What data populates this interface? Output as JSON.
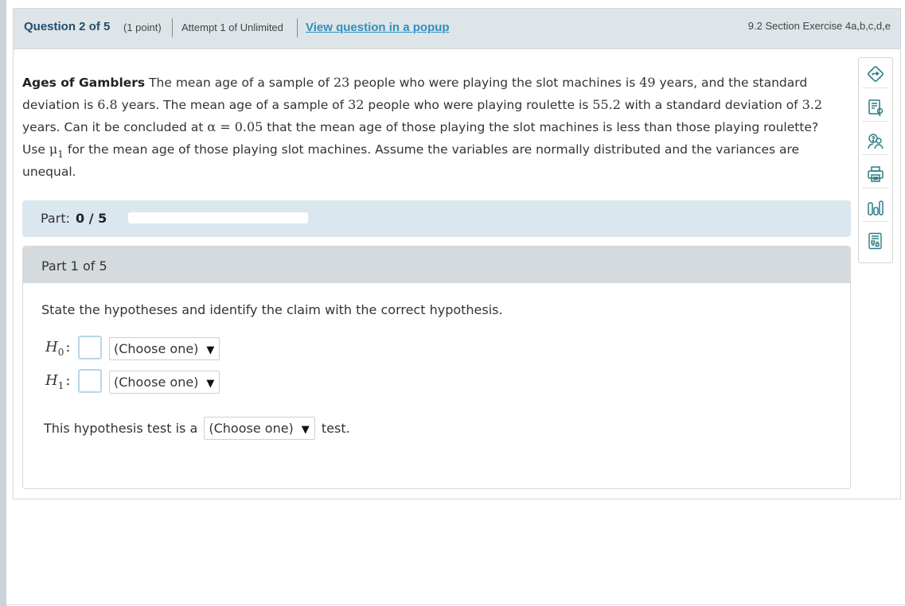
{
  "header": {
    "question_number": "Question 2 of 5",
    "points": "(1 point)",
    "attempt": "Attempt 1 of Unlimited",
    "popup_link": "View question in a popup",
    "section": "9.2 Section Exercise 4a,b,c,d,e"
  },
  "question": {
    "title": "Ages of Gamblers",
    "s1": " The mean age of a sample of ",
    "n1": "23",
    "s2": " people who were playing the slot machines is ",
    "m1": "49",
    "s3": " years, and the standard deviation is ",
    "sd1": "6.8",
    "s4": " years. The mean age of a sample of ",
    "n2": "32",
    "s5": " people who were playing roulette is ",
    "m2": "55.2",
    "s6": " with a standard deviation of ",
    "sd2": "3.2",
    "s7": " years. Can it be concluded at ",
    "alpha_expr": "α = 0.05",
    "s8": " that the mean age of those playing the slot machines is less than those playing roulette? Use ",
    "mu": "μ",
    "mu_sub": "1",
    "s9": " for the mean age of those playing slot machines. Assume the variables are normally distributed and the variances are unequal."
  },
  "progress": {
    "label": "Part:",
    "score": "0 / 5",
    "fraction": 0.0
  },
  "part": {
    "title": "Part 1 of 5",
    "instruction": "State the hypotheses and identify the claim with the correct hypothesis.",
    "h0": {
      "symbol": "H",
      "sub": "0",
      "colon": ":",
      "select": "(Choose one)"
    },
    "h1": {
      "symbol": "H",
      "sub": "1",
      "colon": ":",
      "select": "(Choose one)"
    },
    "test_prefix": "This hypothesis test is a",
    "test_select": "(Choose one)",
    "test_suffix": "test.",
    "arrow": "▼"
  },
  "tools": [
    {
      "icon": "exit-arrow-icon"
    },
    {
      "icon": "hint-document-icon"
    },
    {
      "icon": "ask-question-icon"
    },
    {
      "icon": "printer-icon"
    },
    {
      "icon": "bar-chart-icon"
    },
    {
      "icon": "calculator-icon"
    }
  ],
  "colors": {
    "accent": "#2f8fbf",
    "header_bg": "#dde5e9",
    "part_bar_bg": "#dbe7ef",
    "icon": "#2a7a84"
  }
}
